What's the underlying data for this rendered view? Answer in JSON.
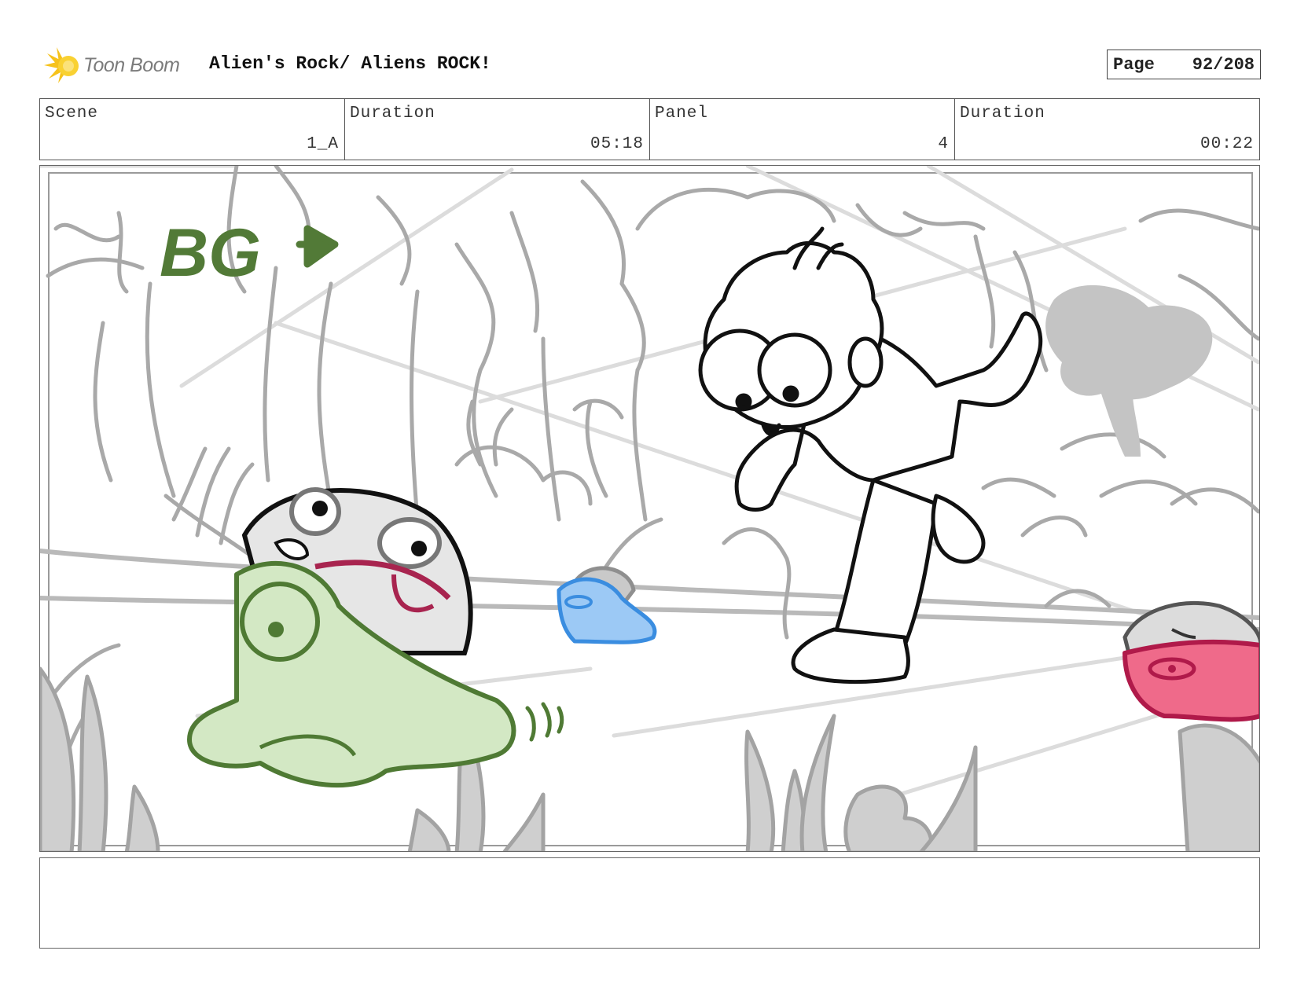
{
  "header": {
    "logo_text": "Toon Boom",
    "project_title": "Alien's Rock/ Aliens ROCK!",
    "page_label": "Page",
    "page_number": "92/208"
  },
  "info": {
    "scene_label": "Scene",
    "scene_value": "1_A",
    "scene_duration_label": "Duration",
    "scene_duration_value": "05:18",
    "panel_label": "Panel",
    "panel_value": "4",
    "panel_duration_label": "Duration",
    "panel_duration_value": "00:22"
  },
  "panel": {
    "sketch_note": "BG",
    "colors": {
      "bg_lines": "#a9a9a9",
      "green_alien": "#d3e8c4",
      "green_outline": "#4f7a34",
      "blue_alien": "#9cc9f5",
      "blue_outline": "#3a8de0",
      "pink_alien": "#ef6a8a",
      "pink_outline": "#b01a4a",
      "mouth": "#a8244f",
      "note_green": "#527a37"
    }
  },
  "notes": {}
}
